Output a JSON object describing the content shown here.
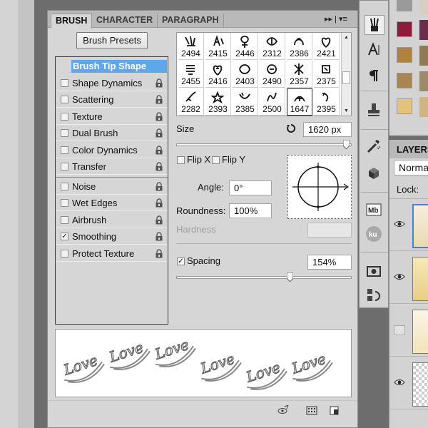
{
  "tabs": {
    "brush": "BRUSH",
    "character": "CHARACTER",
    "paragraph": "PARAGRAPH",
    "menu": "▸▸ | ▾≡"
  },
  "brush_presets_label": "Brush Presets",
  "options": [
    {
      "label": "Brush Tip Shape",
      "header": true
    },
    {
      "label": "Shape Dynamics",
      "checked": false
    },
    {
      "label": "Scattering",
      "checked": false
    },
    {
      "label": "Texture",
      "checked": false
    },
    {
      "label": "Dual Brush",
      "checked": false
    },
    {
      "label": "Color Dynamics",
      "checked": false
    },
    {
      "label": "Transfer",
      "checked": false
    },
    {
      "label": "Noise",
      "checked": false
    },
    {
      "label": "Wet Edges",
      "checked": false
    },
    {
      "label": "Airbrush",
      "checked": false
    },
    {
      "label": "Smoothing",
      "checked": true
    },
    {
      "label": "Protect Texture",
      "checked": false
    }
  ],
  "brush_thumbs": [
    [
      "2494",
      "2415",
      "2446",
      "2312",
      "2386",
      "2421"
    ],
    [
      "2455",
      "2416",
      "2403",
      "2490",
      "2357",
      "2375"
    ],
    [
      "2282",
      "2393",
      "2385",
      "2500",
      "1647",
      "2395"
    ]
  ],
  "selected_thumb": "1647",
  "size": {
    "label": "Size",
    "value": "1620 px",
    "slider_fraction": 0.97
  },
  "flip_x_label": "Flip X",
  "flip_y_label": "Flip Y",
  "angle": {
    "label": "Angle:",
    "value": "0°"
  },
  "roundness": {
    "label": "Roundness:",
    "value": "100%"
  },
  "hardness": {
    "label": "Hardness",
    "value": ""
  },
  "spacing": {
    "label": "Spacing",
    "checked": true,
    "value": "154%",
    "slider_fraction": 0.65
  },
  "stroke_text": "Love",
  "layers": {
    "tab": "LAYERS",
    "blend_mode": "Normal",
    "lock_label": "Lock:"
  },
  "colors": {
    "panel": "#d6d6d6",
    "highlight": "#5fa6ec",
    "tabbar": "#b9b9b9"
  }
}
